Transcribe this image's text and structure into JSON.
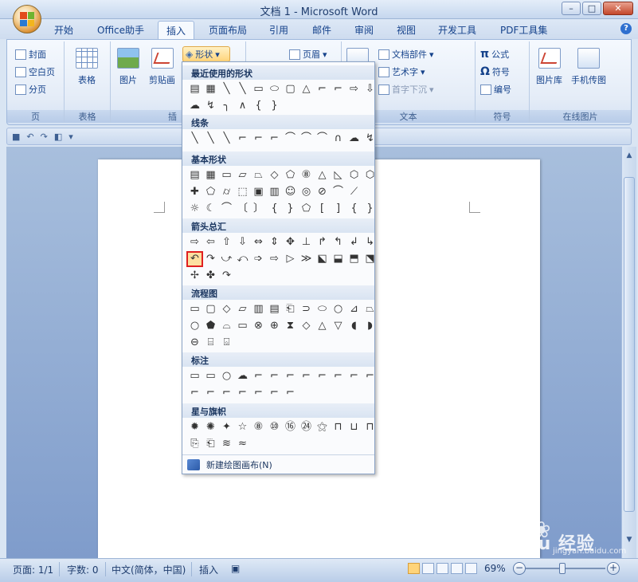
{
  "window": {
    "title": "文档 1 - Microsoft Word",
    "controls": [
      "–",
      "□",
      "✕"
    ]
  },
  "tabs": [
    "开始",
    "Office助手",
    "插入",
    "页面布局",
    "引用",
    "邮件",
    "审阅",
    "视图",
    "开发工具",
    "PDF工具集"
  ],
  "active_tab": "插入",
  "ribbon": {
    "page_group": {
      "items": [
        "封面",
        "空白页",
        "分页"
      ],
      "label": "页"
    },
    "table_group": {
      "button": "表格",
      "label": "表格"
    },
    "illustrations": {
      "picture": "图片",
      "clipart": "剪贴画",
      "shapes": "形状",
      "label": "插"
    },
    "header_footer": {
      "header": "页眉"
    },
    "text_group": {
      "items": [
        "文档部件",
        "艺术字",
        "首字下沉"
      ],
      "label": "文本"
    },
    "symbol_group": {
      "formula": "公式",
      "symbol": "符号",
      "number": "编号",
      "label": "符号"
    },
    "online_group": {
      "gallery": "图片库",
      "phone": "手机传图",
      "label": "在线图片"
    }
  },
  "dropdown": {
    "sections": [
      {
        "title": "最近使用的形状",
        "rows": [
          [
            "▤",
            "▦",
            "╲",
            "╲",
            "▭",
            "⬭",
            "▢",
            "△",
            "⌐",
            "⌐",
            "⇨",
            "⇩"
          ],
          [
            "☁",
            "↯",
            "╮",
            "∧",
            "{",
            "}"
          ]
        ]
      },
      {
        "title": "线条",
        "rows": [
          [
            "╲",
            "╲",
            "╲",
            "⌐",
            "⌐",
            "⌐",
            "⌒",
            "⌒",
            "⌒",
            "∩",
            "☁",
            "↯"
          ]
        ]
      },
      {
        "title": "基本形状",
        "rows": [
          [
            "▤",
            "▦",
            "▭",
            "▱",
            "⏢",
            "◇",
            "⬠",
            "⑧",
            "△",
            "◺",
            "⬡",
            "⬡"
          ],
          [
            "✚",
            "⬠",
            "⌭",
            "⬚",
            "▣",
            "▥",
            "☺",
            "◎",
            "⊘",
            "⌒",
            "⟋"
          ],
          [
            "☼",
            "☾",
            "⌒",
            "〔",
            "〕",
            "{",
            "}",
            "⬠",
            "[",
            "]",
            "{",
            "}"
          ]
        ]
      },
      {
        "title": "箭头总汇",
        "rows": [
          [
            "⇨",
            "⇦",
            "⇧",
            "⇩",
            "⇔",
            "⇕",
            "✥",
            "⊥",
            "↱",
            "↰",
            "↲",
            "↳"
          ],
          [
            "↶",
            "↷",
            "⤻",
            "⤺",
            "➩",
            "⇨",
            "▷",
            "≫",
            "⬕",
            "⬓",
            "⬒",
            "⬔"
          ],
          [
            "✢",
            "✤",
            "↷"
          ]
        ],
        "selected": [
          1,
          0
        ]
      },
      {
        "title": "流程图",
        "rows": [
          [
            "▭",
            "▢",
            "◇",
            "▱",
            "▥",
            "▤",
            "⎗",
            "⊃",
            "⬭",
            "○",
            "⊿",
            "⏢"
          ],
          [
            "○",
            "⬟",
            "⌓",
            "▭",
            "⊗",
            "⊕",
            "⧗",
            "◇",
            "△",
            "▽",
            "◖",
            "◗"
          ],
          [
            "⊖",
            "⌸",
            "⌺"
          ]
        ]
      },
      {
        "title": "标注",
        "rows": [
          [
            "▭",
            "▭",
            "○",
            "☁",
            "⌐",
            "⌐",
            "⌐",
            "⌐",
            "⌐",
            "⌐",
            "⌐",
            "⌐"
          ],
          [
            "⌐",
            "⌐",
            "⌐",
            "⌐",
            "⌐",
            "⌐",
            "⌐"
          ]
        ]
      },
      {
        "title": "星与旗帜",
        "rows": [
          [
            "✹",
            "✺",
            "✦",
            "☆",
            "⑧",
            "⑩",
            "⑯",
            "㉔",
            "⚝",
            "⊓",
            "⊔",
            "⊓"
          ],
          [
            "⎘",
            "⎗",
            "≋",
            "≈"
          ]
        ]
      }
    ],
    "footer": "新建绘图画布(N)"
  },
  "qat": [
    "■",
    "↶",
    "↷",
    "◧",
    "▾"
  ],
  "statusbar": {
    "page": "页面: 1/1",
    "words": "字数: 0",
    "language": "中文(简体，中国)",
    "mode": "插入",
    "zoom": "69%"
  },
  "watermark": {
    "brand": "Bai du 经验",
    "url": "jingyan.baidu.com"
  }
}
